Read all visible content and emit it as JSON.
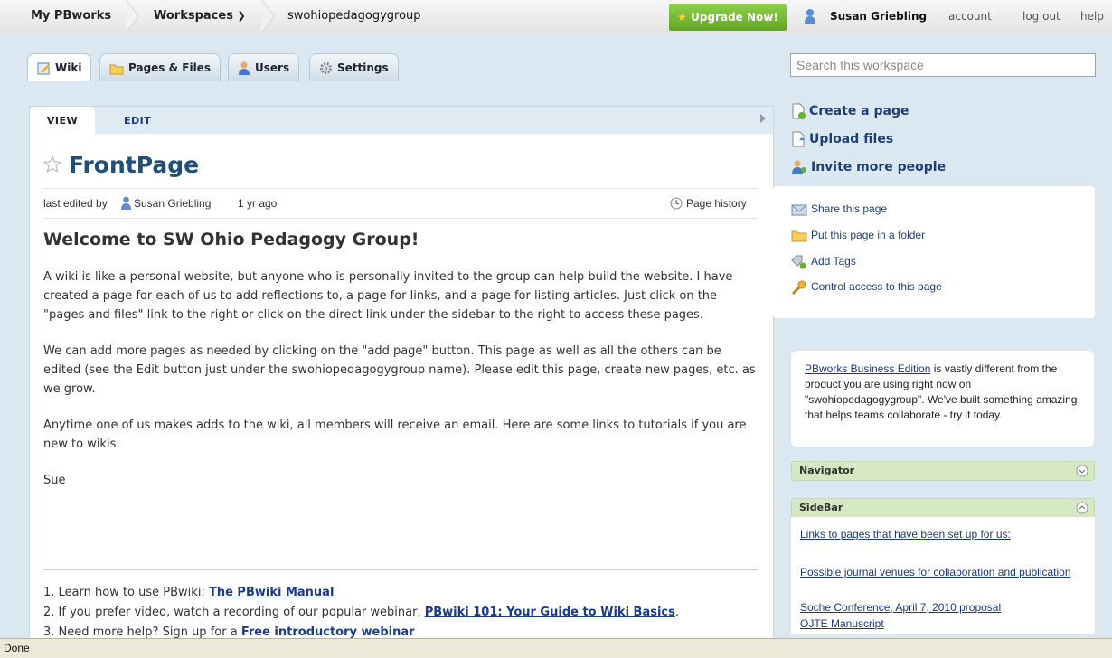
{
  "topbar": {
    "my_pbworks": "My PBworks",
    "workspaces": "Workspaces",
    "workspace_name": "swohiopedagogygroup",
    "upgrade": "Upgrade Now!",
    "user": "Susan Griebling",
    "account": "account",
    "logout": "log out",
    "help": "help"
  },
  "tabs": [
    {
      "label": "Wiki",
      "icon": "wiki-pencil-icon"
    },
    {
      "label": "Pages & Files",
      "icon": "folder-icon"
    },
    {
      "label": "Users",
      "icon": "user-icon"
    },
    {
      "label": "Settings",
      "icon": "gear-icon"
    }
  ],
  "search": {
    "placeholder": "Search this workspace"
  },
  "main": {
    "view_tab": "VIEW",
    "edit_tab": "EDIT",
    "title": "FrontPage",
    "meta": {
      "prefix": "last edited by",
      "author": "Susan Griebling",
      "time": "1 yr ago",
      "history": "Page history"
    },
    "heading": "Welcome to SW Ohio Pedagogy Group!",
    "paragraphs": [
      "A wiki is like a personal website, but anyone who is personally invited to the group can help build the website. I have created a page for each of us to add reflections to, a page for links, and a page for listing articles. Just click on the \"pages and files\" link to the right  or click on the direct link under the sidebar to the right to access these pages.",
      "We can add more pages as needed by clicking on the \"add page\" button. This page as well as all the others can be edited (see the Edit button just under the swohiopedagogygroup name).  Please edit this page, create new pages, etc. as we grow.",
      "Anytime one of us makes adds to the wiki, all members will receive an email. Here are some links to tutorials if you are new to wikis.",
      "Sue"
    ],
    "list": [
      {
        "prefix": "1. Learn how to use PBwiki: ",
        "link": "The PBwiki Manual",
        "suffix": ""
      },
      {
        "prefix": "2. If you prefer video, watch a recording of our popular webinar, ",
        "link": "PBwiki 101: Your Guide to Wiki Basics",
        "suffix": "."
      },
      {
        "prefix": "3. Need more help? Sign up for a ",
        "link": "Free introductory webinar",
        "suffix": ""
      }
    ]
  },
  "sidebar": {
    "actions": [
      "Create a page",
      "Upload files",
      "Invite more people"
    ],
    "share": [
      "Share this page",
      "Put this page in a folder",
      "Add Tags",
      "Control access to this page"
    ],
    "biz_link": "PBworks Business Edition",
    "biz_text": " is vastly different from the product you are using right now on \"swohiopedagogygroup\". We've built something amazing that helps teams collaborate - try it today.",
    "navigator": "Navigator",
    "sidebar_title": "SideBar",
    "sidebar_links": [
      "Links to pages that have been set up for us:",
      "Possible journal venues for collaboration and publication",
      "Soche Conference, April 7, 2010 proposal",
      "OJTE Manuscript"
    ]
  },
  "status": "Done",
  "colors": {
    "accent": "#1f4e79",
    "upgrade": "#6db22e",
    "panel_green": "#d6e8c2"
  }
}
